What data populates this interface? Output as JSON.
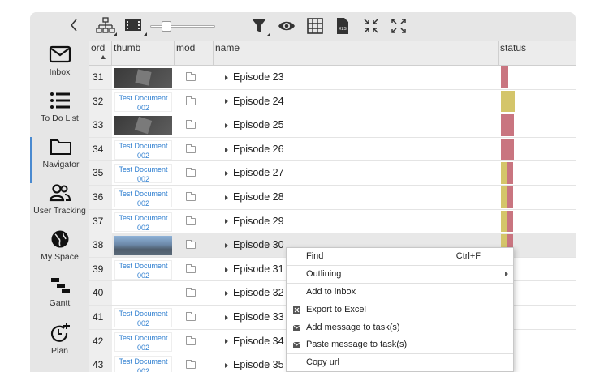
{
  "sidebar": {
    "items": [
      {
        "label": "Inbox",
        "icon": "mail-icon"
      },
      {
        "label": "To Do List",
        "icon": "list-icon"
      },
      {
        "label": "Navigator",
        "icon": "folder-icon"
      },
      {
        "label": "User Tracking",
        "icon": "users-icon"
      },
      {
        "label": "My Space",
        "icon": "globe-icon"
      },
      {
        "label": "Gantt",
        "icon": "gantt-icon"
      },
      {
        "label": "Plan",
        "icon": "clock-plus-icon"
      }
    ]
  },
  "toolbar": {
    "icons": [
      "hierarchy-icon",
      "film-icon",
      "zoom-slider",
      "filter-icon",
      "eye-icon",
      "grid-icon",
      "xls-icon",
      "collapse-icon",
      "expand-icon"
    ],
    "slider_value": 0.25
  },
  "grid": {
    "columns": {
      "ord": "ord",
      "thumb": "thumb",
      "mod": "mod",
      "name": "name",
      "status": "status"
    },
    "rows": [
      {
        "ord": "31",
        "thumb": "",
        "name": "Episode 23"
      },
      {
        "ord": "32",
        "thumb": "Test Document 002",
        "name": "Episode 24"
      },
      {
        "ord": "33",
        "thumb": "",
        "name": "Episode 25"
      },
      {
        "ord": "34",
        "thumb": "Test Document 002",
        "name": "Episode 26"
      },
      {
        "ord": "35",
        "thumb": "Test Document 002",
        "name": "Episode 27"
      },
      {
        "ord": "36",
        "thumb": "Test Document 002",
        "name": "Episode 28"
      },
      {
        "ord": "37",
        "thumb": "Test Document 002",
        "name": "Episode 29"
      },
      {
        "ord": "38",
        "thumb": "",
        "name": "Episode 30"
      },
      {
        "ord": "39",
        "thumb": "Test Document 002",
        "name": "Episode 31"
      },
      {
        "ord": "40",
        "thumb": "",
        "name": "Episode 32"
      },
      {
        "ord": "41",
        "thumb": "Test Document 002",
        "name": "Episode 33"
      },
      {
        "ord": "42",
        "thumb": "Test Document 002",
        "name": "Episode 34"
      },
      {
        "ord": "43",
        "thumb": "Test Document 002",
        "name": "Episode 35"
      }
    ]
  },
  "context_menu": {
    "items": [
      {
        "label": "Find",
        "shortcut": "Ctrl+F"
      },
      {
        "label": "Outlining"
      },
      {
        "label": "Add to inbox"
      },
      {
        "label": "Export to Excel"
      },
      {
        "label": "Add message to task(s)"
      },
      {
        "label": "Paste message to task(s)"
      },
      {
        "label": "Copy url"
      }
    ]
  },
  "colors": {
    "status_red": "#c97580",
    "status_yellow": "#d4c56a",
    "link_blue": "#2f7fd0",
    "active_border": "#4a8ad0"
  }
}
